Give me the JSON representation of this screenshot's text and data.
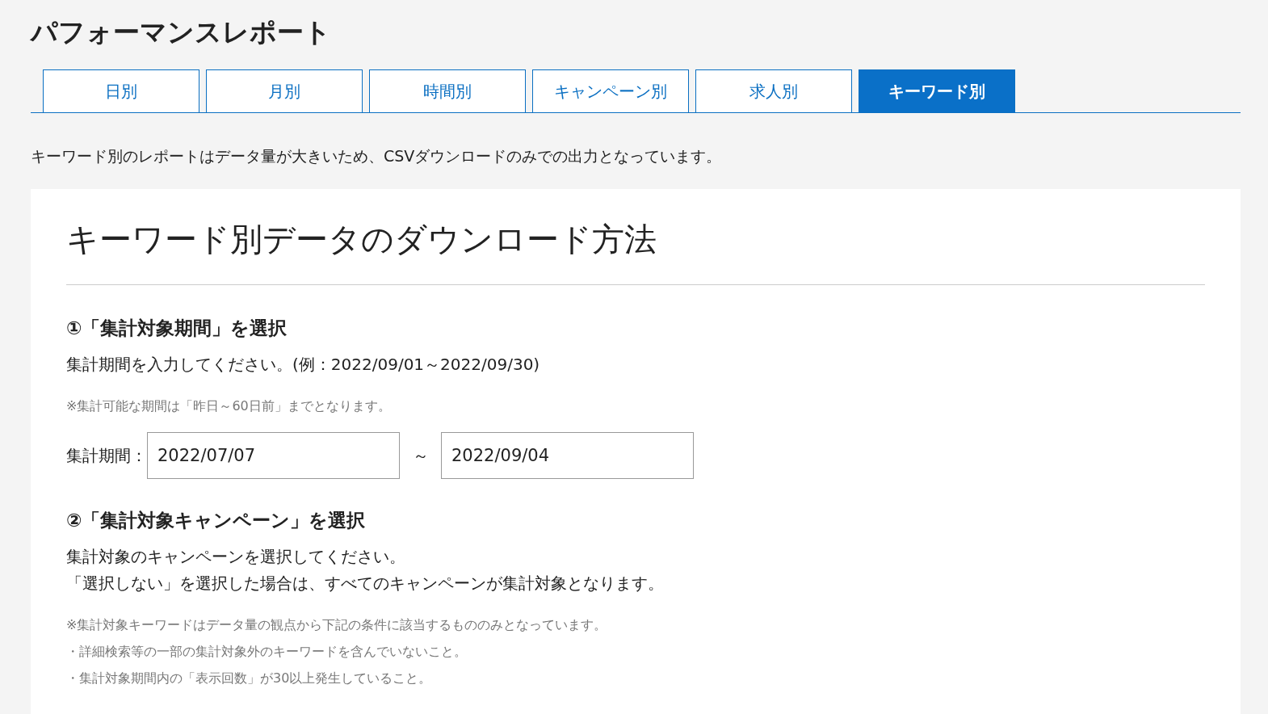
{
  "page_title": "パフォーマンスレポート",
  "tabs": [
    {
      "label": "日別",
      "selected": false
    },
    {
      "label": "月別",
      "selected": false
    },
    {
      "label": "時間別",
      "selected": false
    },
    {
      "label": "キャンペーン別",
      "selected": false
    },
    {
      "label": "求人別",
      "selected": false
    },
    {
      "label": "キーワード別",
      "selected": true
    }
  ],
  "notice": "キーワード別のレポートはデータ量が大きいため、CSVダウンロードのみでの出力となっています。",
  "card": {
    "title": "キーワード別データのダウンロード方法",
    "sections": [
      {
        "heading": "①「集計対象期間」を選択",
        "lines": [
          "集計期間を入力してください。(例：2022/09/01～2022/09/30)"
        ],
        "notes": [
          "※集計可能な期間は「昨日～60日前」までとなります。"
        ],
        "period": {
          "label": "集計期間：",
          "from": "2022/07/07",
          "separator": "～",
          "to": "2022/09/04"
        }
      },
      {
        "heading": "②「集計対象キャンペーン」を選択",
        "lines": [
          "集計対象のキャンペーンを選択してください。",
          "「選択しない」を選択した場合は、すべてのキャンペーンが集計対象となります。"
        ],
        "notes": [
          "※集計対象キーワードはデータ量の観点から下記の条件に該当するもののみとなっています。",
          "・詳細検索等の一部の集計対象外のキーワードを含んでいないこと。",
          "・集計対象期間内の「表示回数」が30以上発生していること。"
        ]
      }
    ]
  }
}
